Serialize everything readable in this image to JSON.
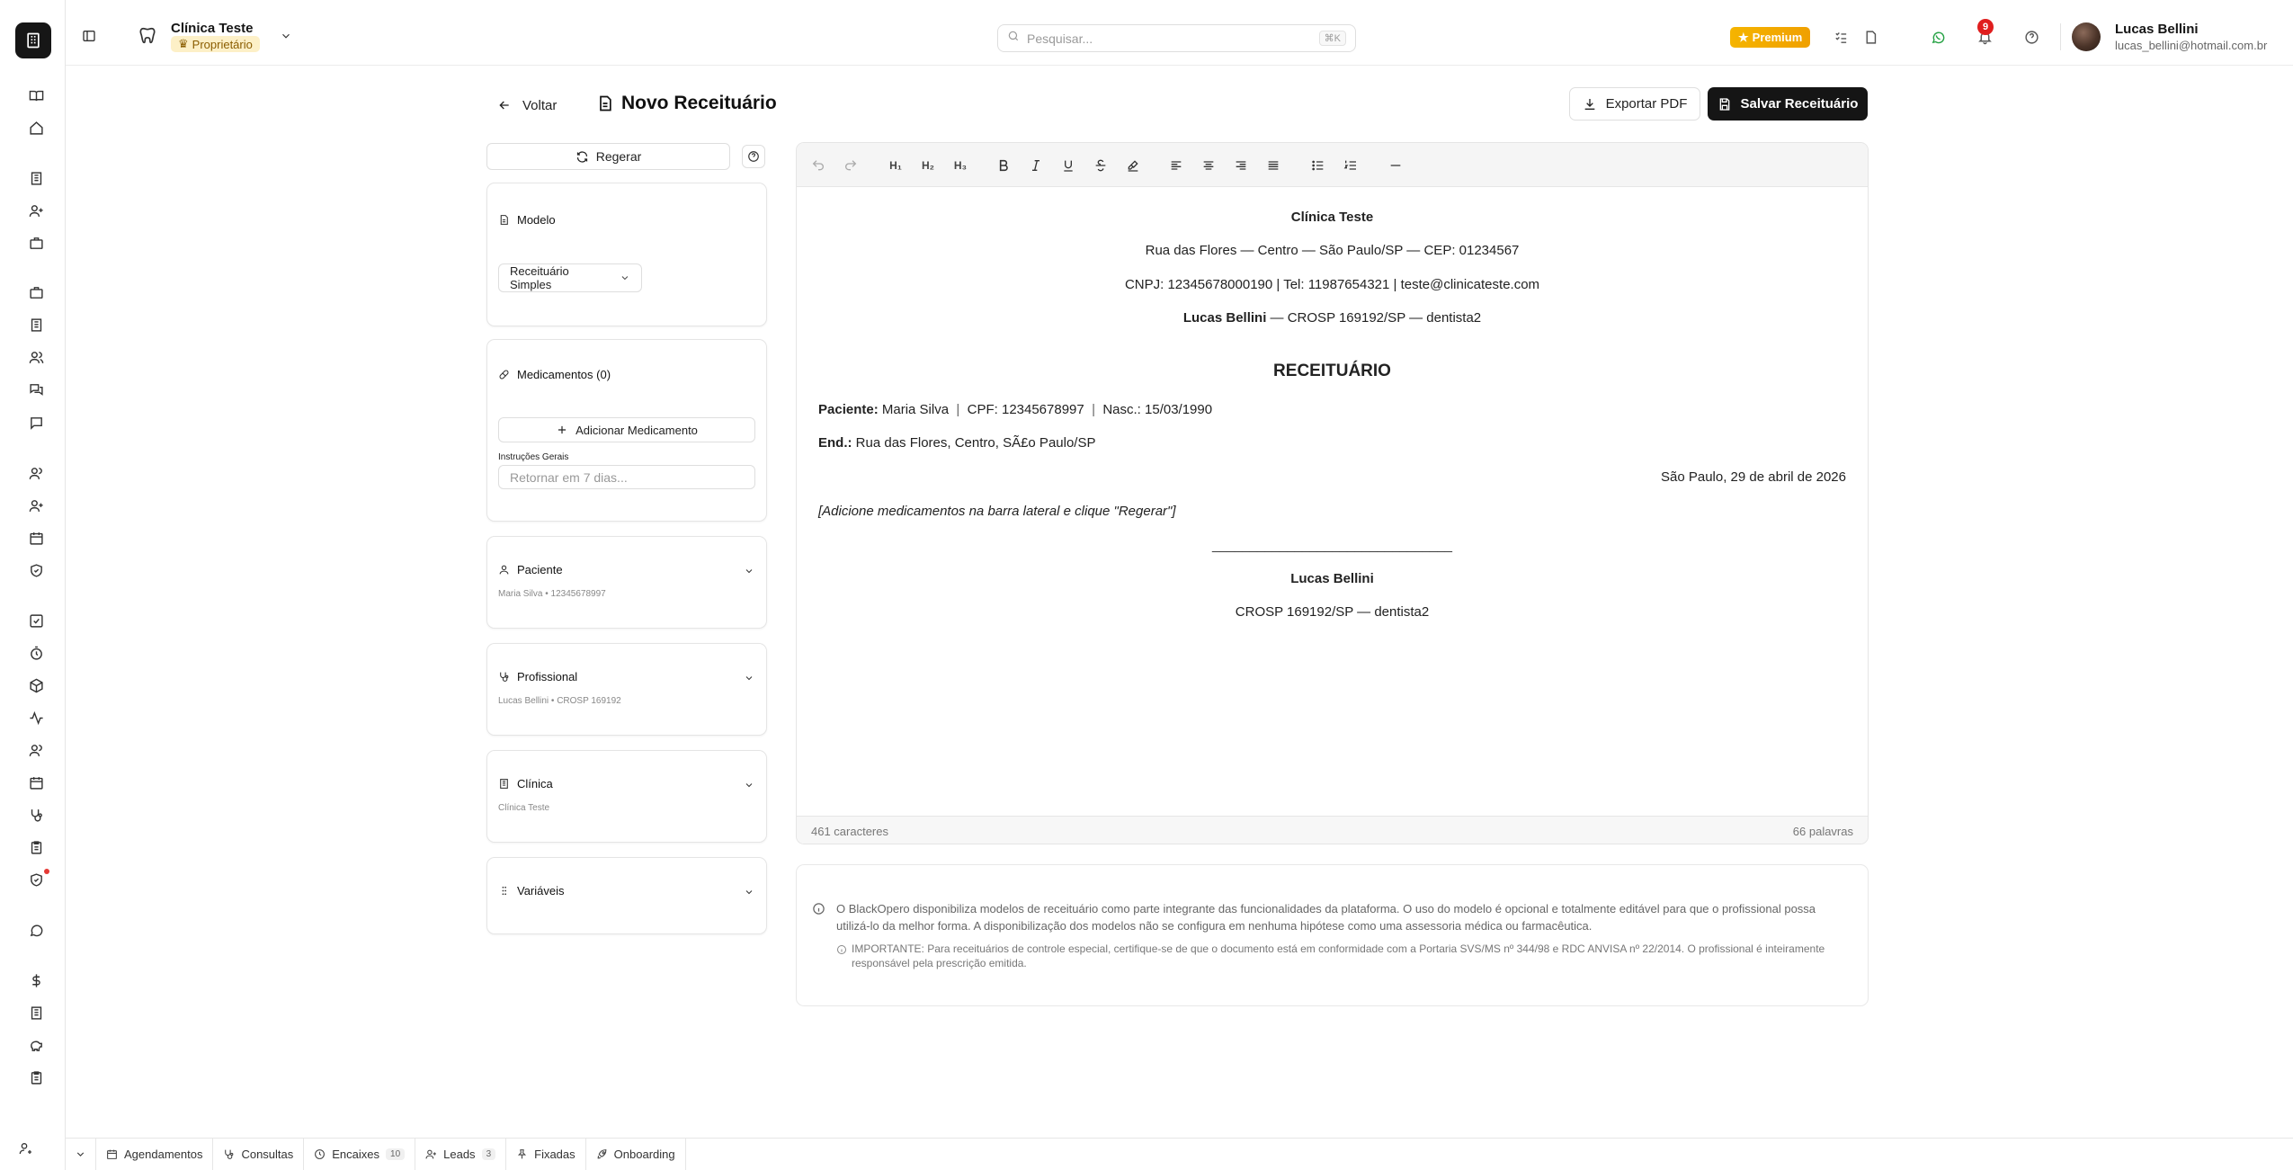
{
  "header": {
    "clinic_name": "Clínica Teste",
    "role_badge": "Proprietário",
    "search_placeholder": "Pesquisar...",
    "search_shortcut": "⌘K",
    "premium_label": "Premium",
    "notification_count": "9",
    "user_name": "Lucas Bellini",
    "user_email": "lucas_bellini@hotmail.com.br"
  },
  "page": {
    "back_label": "Voltar",
    "title": "Novo Receituário",
    "export_label": "Exportar PDF",
    "save_label": "Salvar Receituário"
  },
  "sidebar": {
    "regen_label": "Regerar",
    "model": {
      "title": "Modelo",
      "selected": "Receituário Simples"
    },
    "meds": {
      "title": "Medicamentos (0)",
      "add_label": "Adicionar Medicamento",
      "instructions_label": "Instruções Gerais",
      "instructions_placeholder": "Retornar em 7 dias..."
    },
    "patient": {
      "title": "Paciente",
      "summary": "Maria Silva • 12345678997"
    },
    "professional": {
      "title": "Profissional",
      "summary": "Lucas Bellini • CROSP 169192"
    },
    "clinic": {
      "title": "Clínica",
      "summary": "Clínica Teste"
    },
    "variables": {
      "title": "Variáveis"
    }
  },
  "document": {
    "clinic_name": "Clínica Teste",
    "address": "Rua das Flores — Centro — São Paulo/SP — CEP: 01234567",
    "contact": "CNPJ: 12345678000190 | Tel: 11987654321 | teste@clinicateste.com",
    "prof_name": "Lucas Bellini",
    "prof_rest": " — CROSP 169192/SP — dentista2",
    "heading": "RECEITUÁRIO",
    "patient_label": "Paciente:",
    "patient_name": "Maria Silva",
    "cpf": "CPF: 12345678997",
    "birth": "Nasc.: 15/03/1990",
    "address_label": "End.:",
    "patient_address": "Rua das Flores, Centro, SÃ£o Paulo/SP",
    "date_line": "São Paulo, 29 de abril de 2026",
    "placeholder_note": "[Adicione medicamentos na barra lateral e clique \"Regerar\"]",
    "signature_line": "________________________________",
    "signature_name": "Lucas Bellini",
    "signature_reg": "CROSP 169192/SP — dentista2"
  },
  "editor_footer": {
    "chars": "461 caracteres",
    "words": "66 palavras"
  },
  "disclaimer": {
    "main": "O BlackOpero disponibiliza modelos de receituário como parte integrante das funcionalidades da plataforma. O uso do modelo é opcional e totalmente editável para que o profissional possa utilizá-lo da melhor forma. A disponibilização dos modelos não se configura em nenhuma hipótese como uma assessoria médica ou farmacêutica.",
    "important": "IMPORTANTE: Para receituários de controle especial, certifique-se de que o documento está em conformidade com a Portaria SVS/MS nº 344/98 e RDC ANVISA nº 22/2014. O profissional é inteiramente responsável pela prescrição emitida."
  },
  "bottom_tabs": [
    {
      "label": "Agendamentos",
      "icon": "calendar-icon"
    },
    {
      "label": "Consultas",
      "icon": "stethoscope-icon"
    },
    {
      "label": "Encaixes",
      "icon": "clock-icon",
      "count": "10"
    },
    {
      "label": "Leads",
      "icon": "user-plus-icon",
      "count": "3"
    },
    {
      "label": "Fixadas",
      "icon": "pin-icon"
    },
    {
      "label": "Onboarding",
      "icon": "rocket-icon"
    }
  ],
  "colors": {
    "accent_dark": "#151515",
    "premium": "#f5b400",
    "badge_red": "#e01e1e",
    "whatsapp": "#25a244"
  }
}
